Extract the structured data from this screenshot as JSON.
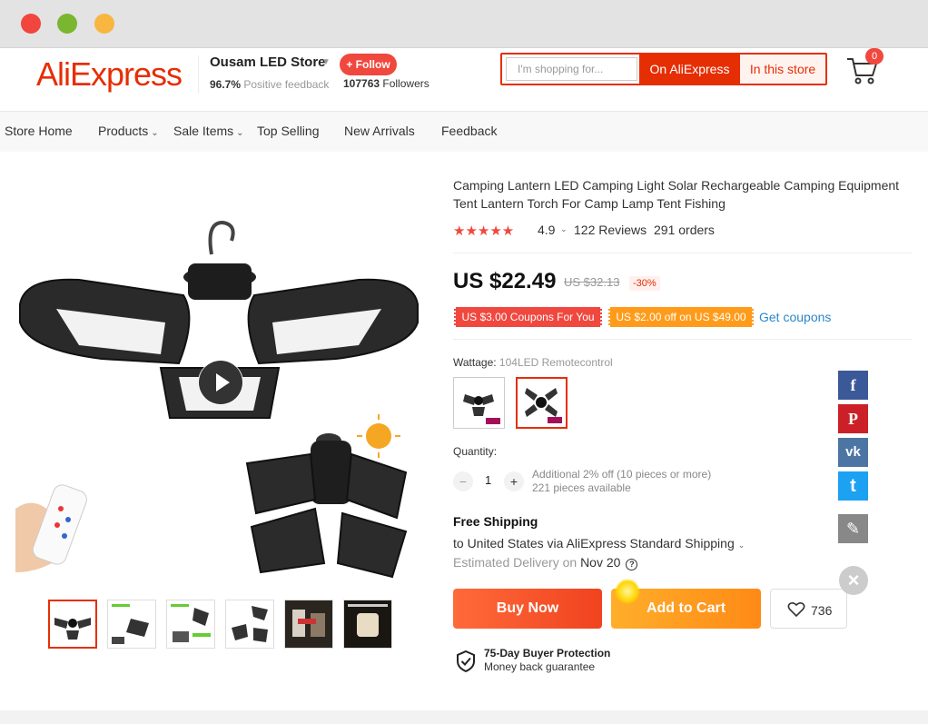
{
  "header": {
    "logo": "AliExpress",
    "store_name": "Ousam LED Store",
    "follow": "+ Follow",
    "positive_pct": "96.7%",
    "positive_label": "Positive feedback",
    "followers_count": "107763",
    "followers_label": "Followers",
    "search_placeholder": "I'm shopping for...",
    "search_ali": "On AliExpress",
    "search_store": "In this store",
    "cart_count": "0"
  },
  "nav": {
    "items": [
      "Store Home",
      "Products",
      "Sale Items",
      "Top Selling",
      "New Arrivals",
      "Feedback"
    ]
  },
  "product": {
    "title": "Camping Lantern LED Camping Light Solar Rechargeable Camping Equipment Tent Lantern Torch For Camp Lamp Tent Fishing",
    "rating": "4.9",
    "stars": 5,
    "reviews": "122 Reviews",
    "orders": "291 orders",
    "price": "US $22.49",
    "old_price": "US $32.13",
    "discount": "-30%",
    "coupon1": "US $3.00 Coupons For You",
    "coupon2": "US $2.00 off on US $49.00",
    "get_coupons": "Get coupons",
    "wattage_label": "Wattage:",
    "wattage_value": "104LED Remotecontrol",
    "quantity_label": "Quantity:",
    "quantity": "1",
    "qty_minus": "−",
    "qty_plus": "+",
    "qty_info1": "Additional 2% off (10 pieces or more)",
    "qty_info2": "221 pieces available",
    "shipping_title": "Free Shipping",
    "shipping_to": "to United States via AliExpress Standard Shipping",
    "delivery_label": "Estimated Delivery on",
    "delivery_date": "Nov 20",
    "buy_now": "Buy Now",
    "add_to_cart": "Add to Cart",
    "wishlist_count": "736",
    "protection_title": "75-Day Buyer Protection",
    "protection_sub": "Money back guarantee"
  },
  "social": {
    "facebook": "f",
    "pinterest": "P",
    "vk": "vk",
    "twitter": "t",
    "edit": "✎",
    "close": "×"
  },
  "colors": {
    "brand": "#e62e04",
    "buy": "#f0431f",
    "cart": "#ff8a16",
    "link": "#2a87c8"
  }
}
